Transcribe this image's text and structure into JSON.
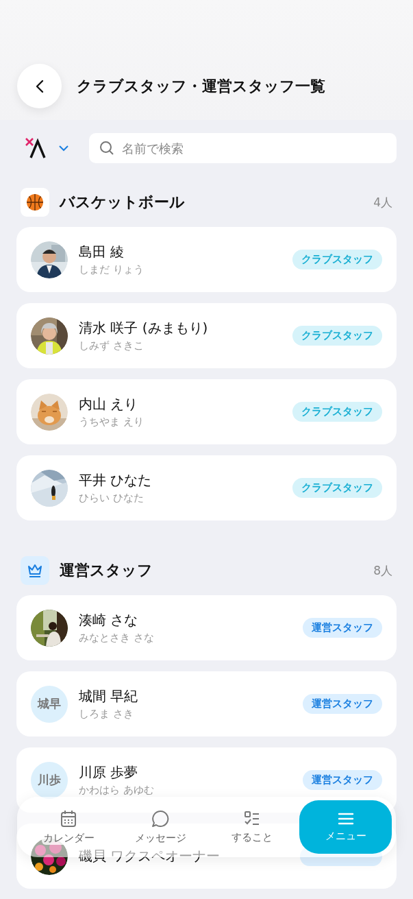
{
  "header": {
    "title": "クラブスタッフ・運営スタッフ一覧"
  },
  "filter": {
    "search": {
      "placeholder": "名前で検索"
    }
  },
  "sections": [
    {
      "kind": "basketball",
      "title": "バスケットボール",
      "count": "4人",
      "members": [
        {
          "name": "島田 綾",
          "reading": "しまだ りょう",
          "badge": {
            "text": "クラブスタッフ",
            "kind": "club"
          }
        },
        {
          "name": "清水 咲子 (みまもり)",
          "reading": "しみず さきこ",
          "badge": {
            "text": "クラブスタッフ",
            "kind": "club"
          }
        },
        {
          "name": "内山 えり",
          "reading": "うちやま えり",
          "badge": {
            "text": "クラブスタッフ",
            "kind": "club"
          }
        },
        {
          "name": "平井 ひなた",
          "reading": "ひらい ひなた",
          "badge": {
            "text": "クラブスタッフ",
            "kind": "club"
          }
        }
      ]
    },
    {
      "kind": "crown",
      "title": "運営スタッフ",
      "count": "8人",
      "members": [
        {
          "name": "湊崎 さな",
          "reading": "みなとさき さな",
          "badge": {
            "text": "運営スタッフ",
            "kind": "ops"
          }
        },
        {
          "name": "城間 早紀",
          "reading": "しろま さき",
          "avatar": {
            "kind": "initials",
            "text": "城早"
          },
          "badge": {
            "text": "運営スタッフ",
            "kind": "ops"
          }
        },
        {
          "name": "川原 歩夢",
          "reading": "かわはら あゆむ",
          "avatar": {
            "kind": "initials",
            "text": "川歩"
          },
          "badge": {
            "text": "運営スタッフ",
            "kind": "ops"
          }
        },
        {
          "name": "磯貝 ワクスペオーナー",
          "badge": {
            "kind": "ops"
          }
        }
      ]
    }
  ],
  "nav": [
    {
      "label": "カレンダー",
      "selected": false
    },
    {
      "label": "メッセージ",
      "selected": false
    },
    {
      "label": "すること",
      "selected": false
    },
    {
      "label": "メニュー",
      "selected": true
    }
  ]
}
